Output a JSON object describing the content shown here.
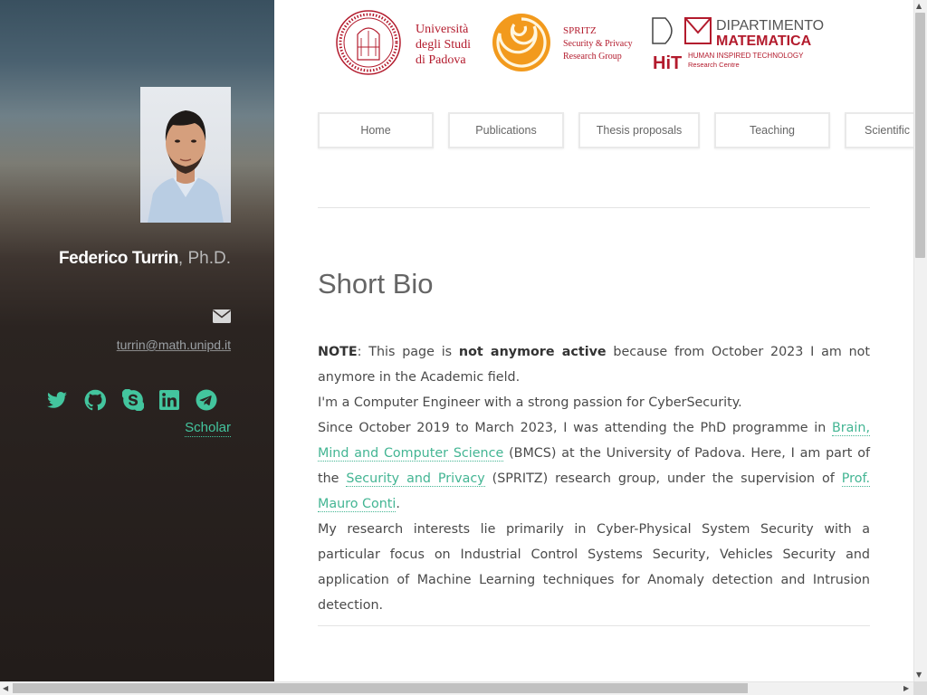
{
  "sidebar": {
    "name": "Federico Turrin",
    "title_suffix": ", Ph.D.",
    "email": "turrin@math.unipd.it",
    "scholar_label": "Scholar",
    "social_icons": [
      "twitter-icon",
      "github-icon",
      "skype-icon",
      "linkedin-icon",
      "telegram-icon"
    ],
    "accent_color": "#43c59e"
  },
  "header": {
    "logos": {
      "unipd": {
        "line1": "Università",
        "line2": "degli Studi",
        "line3": "di Padova"
      },
      "spritz": {
        "line1": "SPRITZ",
        "line2": "Security & Privacy",
        "line3": "Research Group"
      },
      "dm": {
        "line1": "DIPARTIMENTO",
        "line2": "MATEMATICA"
      },
      "hit": {
        "mark": "HiT",
        "line1": "HUMAN INSPIRED TECHNOLOGY",
        "line2": "Research Centre"
      }
    },
    "brand_color": "#b31b2d"
  },
  "nav": {
    "items": [
      "Home",
      "Publications",
      "Thesis proposals",
      "Teaching",
      "Scientific S"
    ]
  },
  "bio": {
    "heading": "Short Bio",
    "note_label": "NOTE",
    "note_text_1": ": This page is ",
    "note_bold": "not anymore active",
    "note_text_2": " because from October 2023 I am not anymore in the Academic field.",
    "line2": "I'm a Computer Engineer with a strong passion for CyberSecurity.",
    "p3_a": "Since October 2019 to March 2023, I was attending the PhD programme in ",
    "p3_link1": "Brain, Mind and Computer Science",
    "p3_b": " (BMCS) at the University of Padova. Here, I am part of the ",
    "p3_link2": "Security and Privacy",
    "p3_c": " (SPRITZ) research group, under the supervision of ",
    "p3_link3": "Prof. Mauro Conti",
    "p3_d": ".",
    "p4": "My research interests lie primarily in Cyber-Physical System Security with a particular focus on Industrial Control Systems Security, Vehicles Security and application of Machine Learning techniques for Anomaly detection and Intrusion detection.",
    "link_color": "#43b593"
  }
}
